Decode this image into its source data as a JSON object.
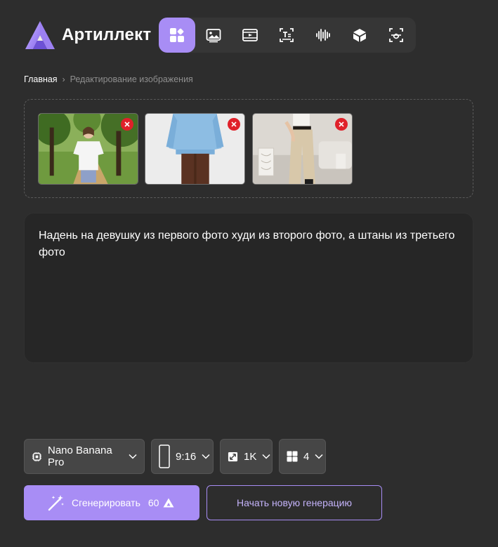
{
  "brand": {
    "name": "Артиллект",
    "accent_color": "#a88df5",
    "logo_icon": "artillect-logo-icon"
  },
  "nav": {
    "items": [
      {
        "icon": "apps-grid-icon",
        "active": true
      },
      {
        "icon": "image-icon",
        "active": false
      },
      {
        "icon": "video-icon",
        "active": false
      },
      {
        "icon": "text-recognition-icon",
        "active": false
      },
      {
        "icon": "audio-wave-icon",
        "active": false
      },
      {
        "icon": "3d-cube-icon",
        "active": false
      },
      {
        "icon": "face-scan-icon",
        "active": false
      }
    ]
  },
  "breadcrumb": {
    "home": "Главная",
    "separator": "›",
    "current": "Редактирование изображения"
  },
  "uploads": {
    "images": [
      {
        "icon": "photo-woman-park-icon"
      },
      {
        "icon": "photo-blue-hoodie-icon"
      },
      {
        "icon": "photo-beige-trousers-icon"
      }
    ],
    "remove_color": "#e0212a"
  },
  "prompt": {
    "text": "Надень на девушку из первого фото худи из второго фото, а штаны из третьего фото"
  },
  "options": {
    "model": "Nano Banana Pro",
    "aspect_ratio": "9:16",
    "resolution": "1K",
    "count": "4"
  },
  "actions": {
    "generate_label": "Сгенерировать",
    "generate_cost": "60",
    "new_generation_label": "Начать новую генерацию"
  }
}
